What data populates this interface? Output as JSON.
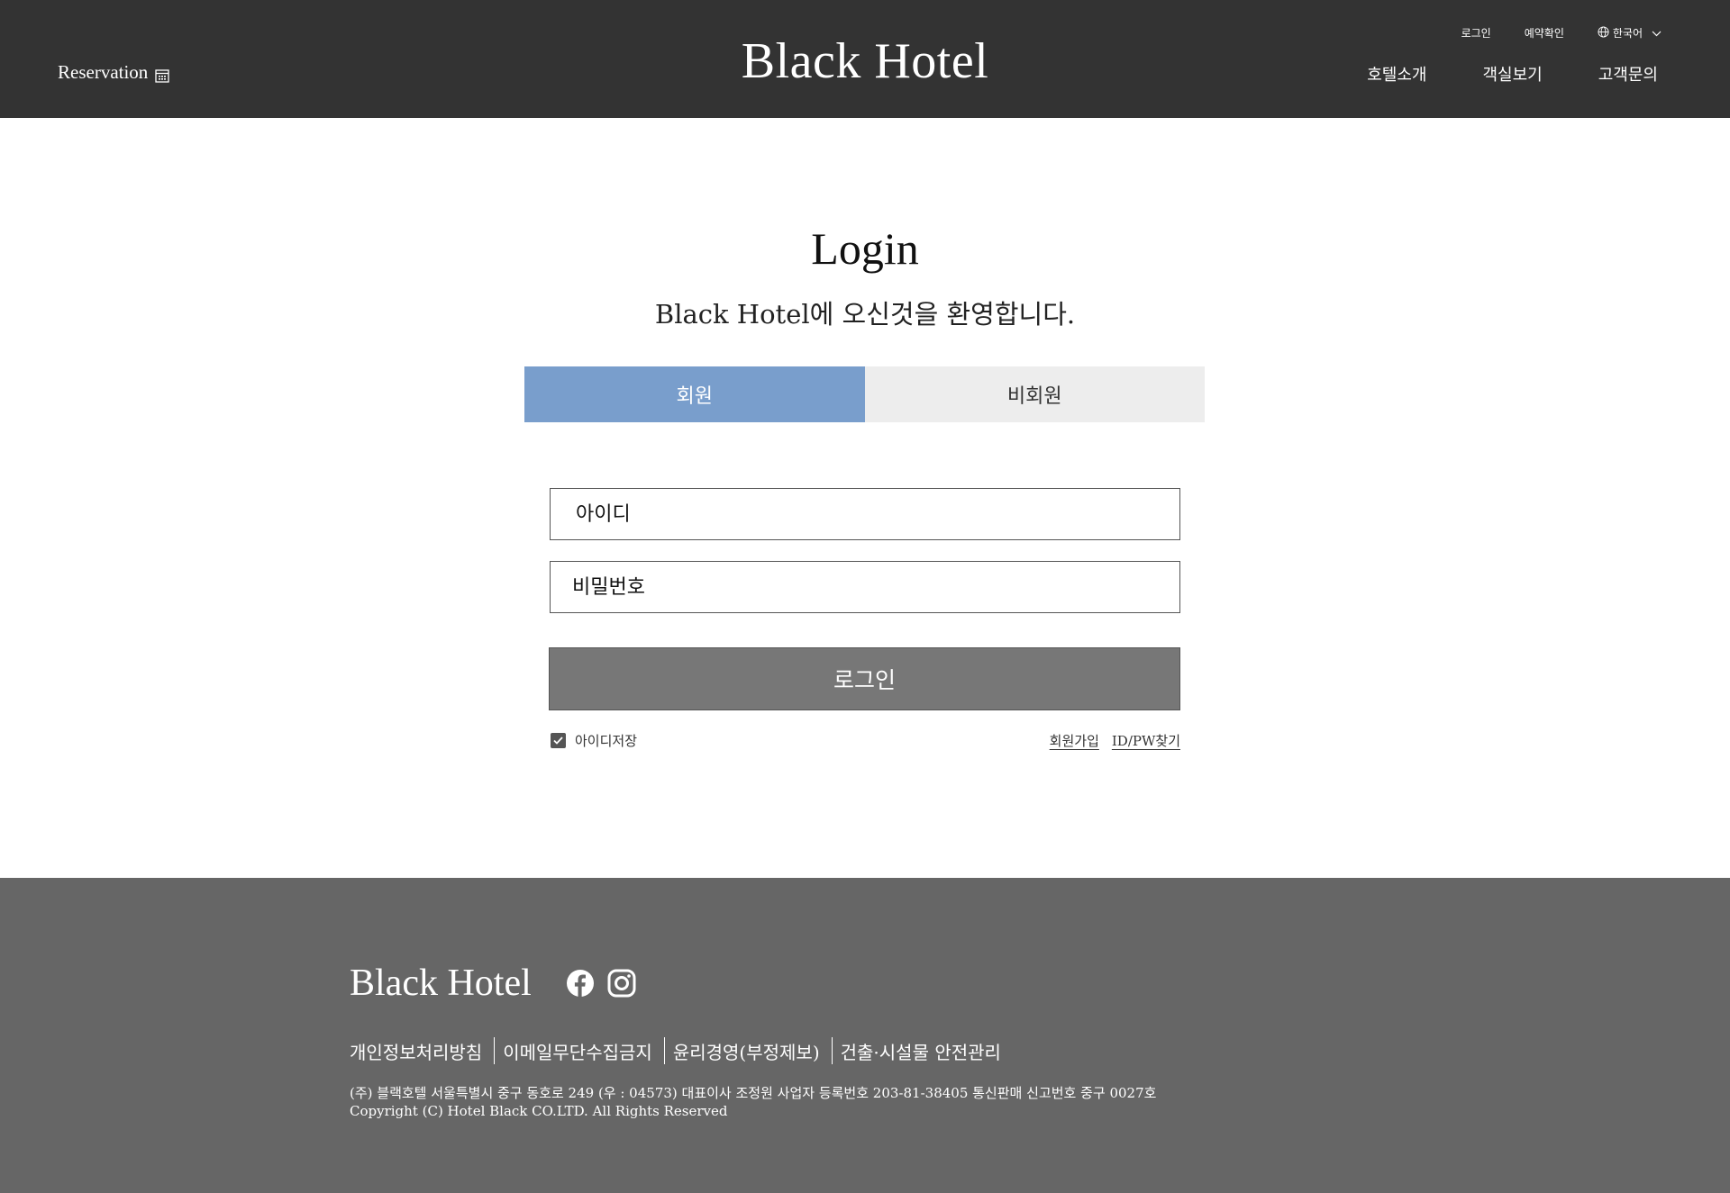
{
  "header": {
    "reservation_label": "Reservation",
    "brand": "Black Hotel",
    "util": {
      "login": "로그인",
      "reservation_check": "예약확인",
      "language": "한국어"
    },
    "nav": [
      "호텔소개",
      "객실보기",
      "고객문의"
    ]
  },
  "login": {
    "title": "Login",
    "welcome": "Black Hotel에 오신것을 환영합니다.",
    "tabs": {
      "member": "회원",
      "non_member": "비회원",
      "active": "member"
    },
    "id_placeholder": "아이디",
    "pw_placeholder": "비밀번호",
    "submit_label": "로그인",
    "save_id_label": "아이디저장",
    "save_id_checked": true,
    "signup_link": "회원가입",
    "find_link": "ID/PW찾기"
  },
  "footer": {
    "brand": "Black Hotel",
    "social": [
      "facebook-icon",
      "instagram-icon"
    ],
    "links": [
      "개인정보처리방침",
      "이메일무단수집금지",
      "윤리경영(부정제보)",
      "건출·시설물 안전관리"
    ],
    "address": "(주) 블랙호텔 서울특별시 중구 동호로 249 (우 : 04573) 대표이사 조정원   사업자 등록번호  203-81-38405 통신판매 신고번호 중구 0027호",
    "copyright": "Copyright (C) Hotel Black CO.LTD. All Rights Reserved"
  },
  "colors": {
    "header_bg": "#333333",
    "tab_active": "#799ecc",
    "tab_inactive": "#ededed",
    "button_bg": "#777777",
    "footer_bg": "#666666"
  }
}
